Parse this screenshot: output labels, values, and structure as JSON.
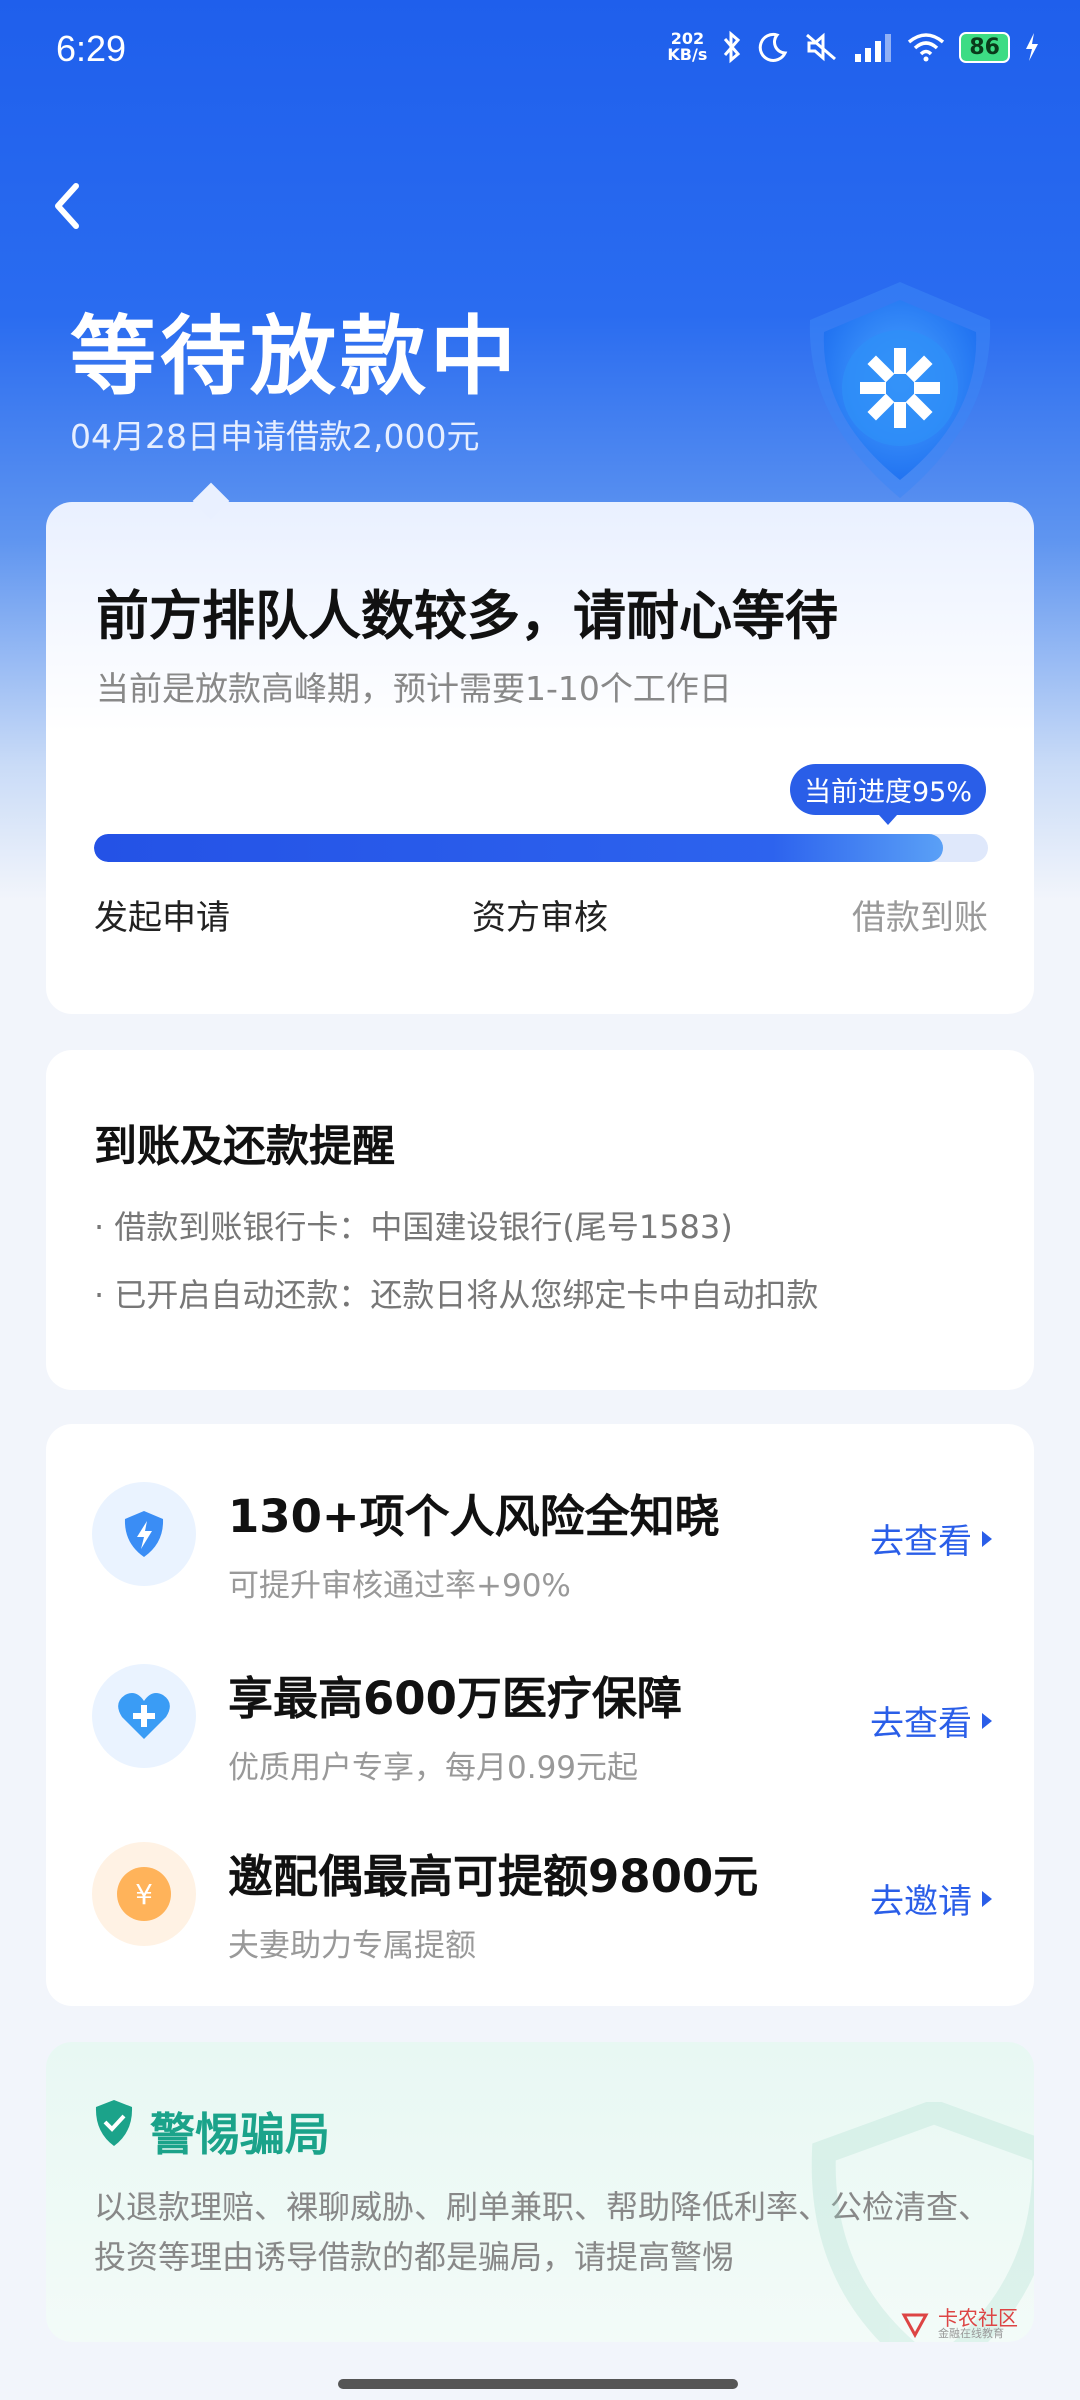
{
  "status_bar": {
    "time": "6:29",
    "speed_value": "202",
    "speed_unit": "KB/s",
    "battery": "86"
  },
  "header": {
    "title": "等待放款中",
    "subtitle": "04月28日申请借款2,000元"
  },
  "progress_card": {
    "title": "前方排队人数较多，请耐心等待",
    "subtitle": "当前是放款高峰期，预计需要1-10个工作日",
    "progress_label": "当前进度95%",
    "progress_fraction": 0.95,
    "steps": [
      "发起申请",
      "资方审核",
      "借款到账"
    ]
  },
  "reminder_card": {
    "title": "到账及还款提醒",
    "lines": [
      "· 借款到账银行卡：中国建设银行(尾号1583)",
      "· 已开启自动还款：还款日将从您绑定卡中自动扣款"
    ]
  },
  "services": [
    {
      "title": "130+项个人风险全知晓",
      "subtitle": "可提升审核通过率+90%",
      "action": "去查看",
      "icon": "shield-bolt-icon"
    },
    {
      "title": "享最高600万医疗保障",
      "subtitle": "优质用户专享，每月0.99元起",
      "action": "去查看",
      "icon": "heart-plus-icon"
    },
    {
      "title": "邀配偶最高可提额9800元",
      "subtitle": "夫妻助力专属提额",
      "action": "去邀请",
      "icon": "yen-coin-icon"
    }
  ],
  "fraud_card": {
    "title": "警惕骗局",
    "body": "以退款理赔、裸聊威胁、刷单兼职、帮助降低利率、公检清查、投资等理由诱导借款的都是骗局，请提高警惕"
  },
  "watermark": {
    "line1": "卡农社区",
    "line2": "金融在线教育"
  },
  "colors": {
    "primary": "#2a5ee8",
    "hero_top": "#1f5fec",
    "fraud_green": "#1ba38a"
  }
}
